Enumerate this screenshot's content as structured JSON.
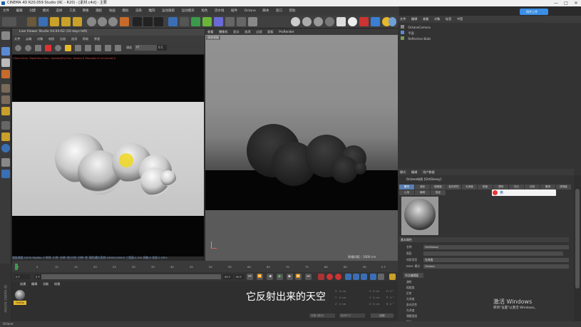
{
  "window": {
    "title": "CINEMA 4D R20.059 Studio (RC - R20) - [素材.c4d] - 主要",
    "controls": [
      "—",
      "□",
      "✕"
    ]
  },
  "menubar": [
    "文件",
    "编辑",
    "创建",
    "模式",
    "选择",
    "工具",
    "网格",
    "捕捉",
    "动画",
    "模拟",
    "渲染",
    "雕刻",
    "运动跟踪",
    "运动图形",
    "角色",
    "流水线",
    "插件",
    "Octane",
    "脚本",
    "窗口",
    "帮助"
  ],
  "live_viewer": {
    "title": "Live Viewer Studio V4.04-R2 (10 days left)",
    "menu": [
      "文件",
      "云端",
      "对象",
      "材质",
      "比较",
      "选项",
      "帮助",
      "界面"
    ],
    "preset_label": "通道",
    "preset_value": "PT",
    "zoom_value": "0.5",
    "log": "Check:0ms. MeshGen:0ms. Update[M]:0ms. Nodes:0 Movable:0 txCached:0",
    "status": "渲染进度:100%  Ms/Mp: 0  时间: 小时: 分钟: 秒/小时: 分钟: 秒  采样/最大采样:16000/16000  三角面:0.20k  网格:0  毛发:0  GPU:"
  },
  "viewport": {
    "menu": [
      "查看",
      "摄像机",
      "显示",
      "选项",
      "过滤",
      "面板",
      "ProRender"
    ],
    "camera_label": "透视视图",
    "distance": "网格间距 : 1000 cm"
  },
  "objects": {
    "tabs": [
      "文件",
      "编辑",
      "查看",
      "对象",
      "标签",
      "书签"
    ],
    "items": [
      "OctaneCamera",
      "平面",
      "Reflective Balls"
    ]
  },
  "attributes": {
    "menu": [
      "模式",
      "编辑",
      "用户数据"
    ],
    "material_name": "Octane材质 [OctGlossy]",
    "tabs_row1": [
      "基本",
      "漫射",
      "粗糙度",
      "各向异性",
      "光泽度",
      "镜面",
      "透明",
      "凹凸",
      "法线",
      "置换",
      "透明度",
      "离子"
    ],
    "tabs_row2": [
      "公用",
      "编辑",
      "指定"
    ],
    "section": "基本属性",
    "fields": [
      {
        "label": "名称",
        "value": "OctGlossy"
      },
      {
        "label": "图层",
        "value": ""
      },
      {
        "label": "材质类型",
        "value": "光泽度"
      },
      {
        "label": "BRDF 模式",
        "value": "Octane"
      }
    ],
    "section2": "节点编辑器",
    "channels": [
      "漫射",
      "粗糙度",
      "反射",
      "光泽度",
      "各向异性",
      "光泽度",
      "薄膜宽度",
      "凹凸"
    ]
  },
  "timeline": {
    "ticks": [
      "0",
      "5",
      "10",
      "15",
      "20",
      "25",
      "30",
      "35",
      "40",
      "45",
      "50",
      "55",
      "60",
      "65",
      "70",
      "75",
      "80",
      "85",
      "90"
    ],
    "start": "0 F",
    "current": "0 F",
    "end": "90 F",
    "end2": "90 F",
    "frame_marker": "0 F"
  },
  "material_manager": {
    "menu": [
      "创建",
      "编辑",
      "功能",
      "纹理"
    ],
    "material_label": "OctGlo"
  },
  "coords": {
    "rows": [
      {
        "axis": "X",
        "v1": "0 cm",
        "axis2": "X",
        "v2": "0 cm",
        "axis3": "H",
        "v3": "0 °"
      },
      {
        "axis": "Y",
        "v1": "0 cm",
        "axis2": "Y",
        "v2": "0 cm",
        "axis3": "P",
        "v3": "0 °"
      },
      {
        "axis": "Z",
        "v1": "0 cm",
        "axis2": "Z",
        "v2": "0 cm",
        "axis3": "B",
        "v3": "0 °"
      }
    ],
    "mode": "对象 (相对)",
    "size_mode": "绝对尺寸",
    "apply": "应用"
  },
  "subtitle": "它反射出来的天空",
  "windows_activation": {
    "line1": "激活 Windows",
    "line2": "转到\"设置\"以激活 Windows。"
  },
  "statusbar": "Octane",
  "ime_label": "英",
  "cloud_button": "同步上传",
  "brand": "MAXON CINEMA 4D"
}
